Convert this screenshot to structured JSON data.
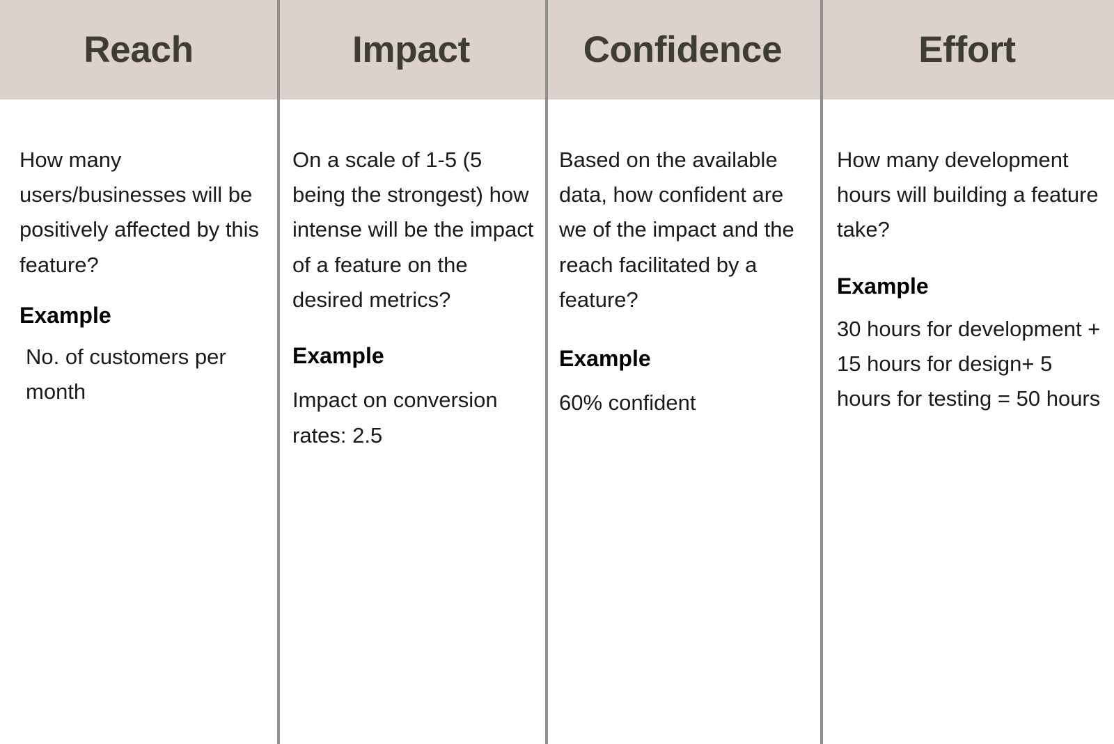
{
  "theme": {
    "header_background": "#dcd2cb",
    "header_text_color": "#3d3d35",
    "divider_color": "#919191",
    "body_background": "#ffffff",
    "body_text_color": "#1a1a1a"
  },
  "columns": [
    {
      "id": "reach",
      "header": "Reach",
      "question": "How many users/businesses will be positively affected by this feature?",
      "example_label": "Example",
      "example_value": "No. of customers per month"
    },
    {
      "id": "impact",
      "header": "Impact",
      "question": "On a scale of 1-5 (5 being the strongest) how intense will be the impact of a feature on the desired metrics?",
      "example_label": "Example",
      "example_value": "Impact on conversion rates: 2.5"
    },
    {
      "id": "confidence",
      "header": "Confidence",
      "question": "Based on the available data, how confident are we of the impact and the reach facilitated by a feature?",
      "example_label": "Example",
      "example_value": "60% confident"
    },
    {
      "id": "effort",
      "header": "Effort",
      "question": "How many development hours will building a feature take?",
      "example_label": "Example",
      "example_value": "30 hours for development + 15 hours for design+ 5 hours for testing = 50 hours"
    }
  ]
}
